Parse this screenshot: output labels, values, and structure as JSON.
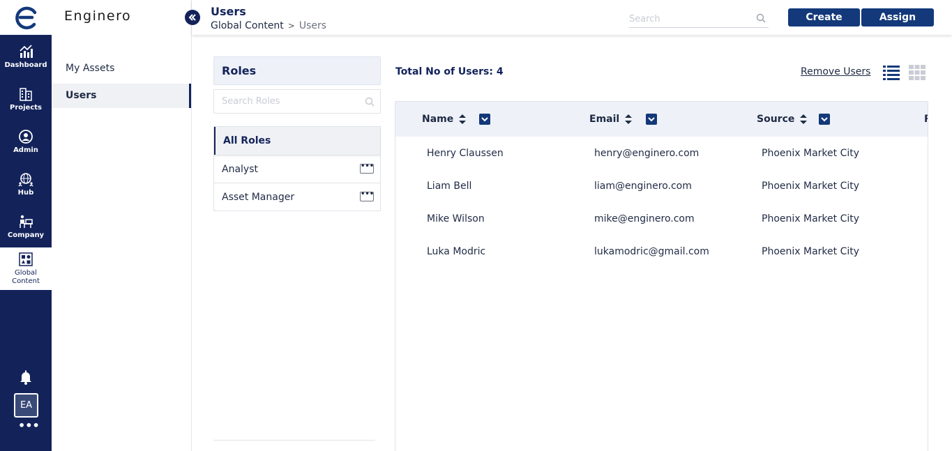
{
  "app": {
    "brand": "Enginero"
  },
  "rail": {
    "items": [
      {
        "label": "Dashboard",
        "icon": "chart-up-icon"
      },
      {
        "label": "Projects",
        "icon": "building-icon"
      },
      {
        "label": "Admin",
        "icon": "user-circle-icon"
      },
      {
        "label": "Hub",
        "icon": "globe-people-icon"
      },
      {
        "label": "Company",
        "icon": "office-desk-icon"
      },
      {
        "label_line1": "Global",
        "label_line2": "Content",
        "icon": "shapes-icon",
        "active": true
      }
    ],
    "avatar": "EA",
    "more": "•••"
  },
  "subnav": {
    "items": [
      {
        "label": "My Assets"
      },
      {
        "label": "Users",
        "active": true
      }
    ]
  },
  "header": {
    "title": "Users",
    "breadcrumb": {
      "parent": "Global Content",
      "separator": ">",
      "current": "Users"
    },
    "search_placeholder": "Search",
    "create_label": "Create",
    "assign_label": "Assign"
  },
  "roles": {
    "title": "Roles",
    "search_placeholder": "Search Roles",
    "items": [
      {
        "label": "All Roles",
        "active": true
      },
      {
        "label": "Analyst",
        "more": "•••"
      },
      {
        "label": "Asset Manager",
        "more": "•••"
      }
    ]
  },
  "users": {
    "total_label": "Total No of Users: 4",
    "remove_label": "Remove Users",
    "columns": [
      "Name",
      "Email",
      "Source",
      "R"
    ],
    "rows": [
      {
        "name": "Henry Claussen",
        "email": "henry@enginero.com",
        "source": "Phoenix Market City"
      },
      {
        "name": "Liam Bell",
        "email": "liam@enginero.com",
        "source": "Phoenix Market City"
      },
      {
        "name": "Mike Wilson",
        "email": "mike@enginero.com",
        "source": "Phoenix Market City"
      },
      {
        "name": "Luka Modric",
        "email": "lukamodric@gmail.com",
        "source": "Phoenix Market City"
      }
    ]
  },
  "colors": {
    "navy": "#13235a",
    "button": "#13397a",
    "header_bg": "#eef2f8"
  }
}
